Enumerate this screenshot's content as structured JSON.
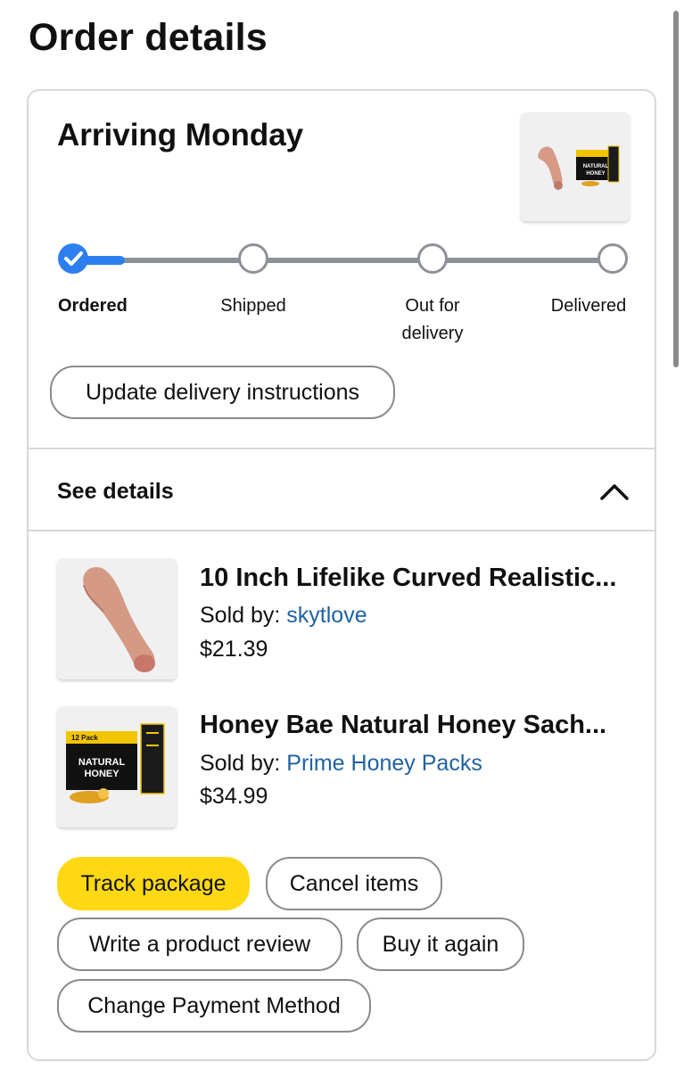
{
  "page": {
    "title": "Order details"
  },
  "shipment": {
    "arrival": "Arriving Monday",
    "steps": [
      {
        "label": "Ordered",
        "label_line2": "",
        "status": "complete"
      },
      {
        "label": "Shipped",
        "label_line2": "",
        "status": "pending"
      },
      {
        "label": "Out for",
        "label_line2": "delivery",
        "status": "pending"
      },
      {
        "label": "Delivered",
        "label_line2": "",
        "status": "pending"
      }
    ],
    "update_button": "Update delivery instructions"
  },
  "details": {
    "toggle_label": "See details",
    "expanded": true,
    "items": [
      {
        "title": "10 Inch Lifelike Curved Realistic...",
        "sold_by_label": "Sold by:",
        "seller": "skytlove",
        "price": "$21.39"
      },
      {
        "title": "Honey Bae Natural Honey Sach...",
        "sold_by_label": "Sold by:",
        "seller": "Prime Honey Packs",
        "price": "$34.99"
      }
    ],
    "honey_box": {
      "pack_text": "12 Pack",
      "brand_line1": "NATURAL",
      "brand_line2": "HONEY"
    }
  },
  "actions": {
    "track": "Track package",
    "cancel": "Cancel items",
    "review": "Write a product review",
    "buy_again": "Buy it again",
    "change_payment": "Change Payment Method"
  },
  "colors": {
    "accent_blue": "#2d7ff0",
    "link_blue": "#2162a1",
    "primary_button": "#ffd814",
    "border": "#d5d9d9"
  }
}
